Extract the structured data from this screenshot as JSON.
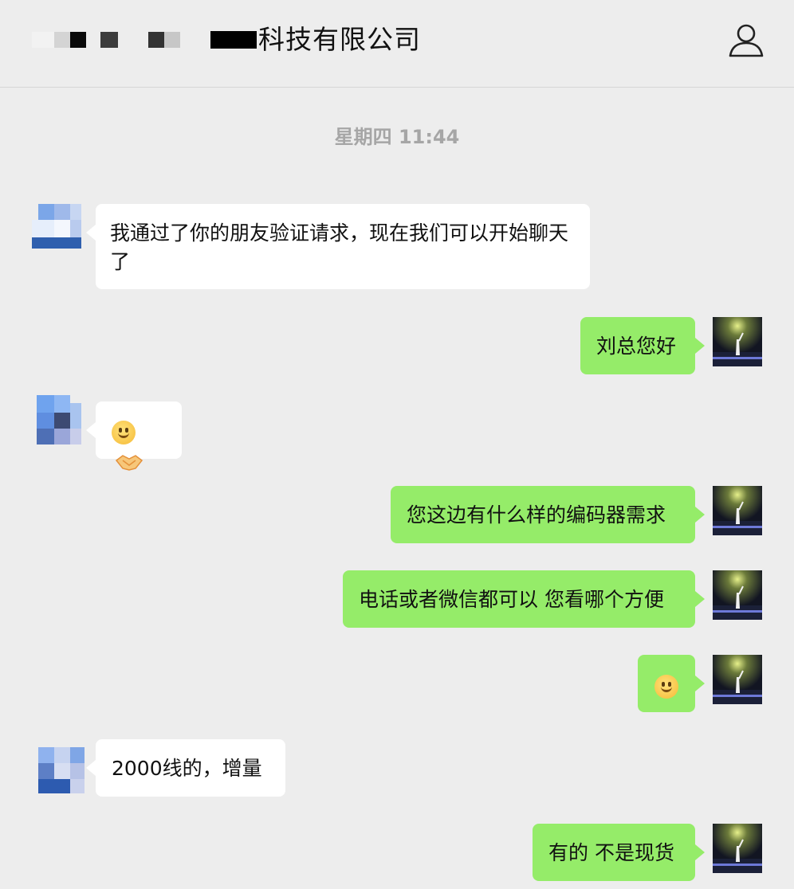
{
  "header": {
    "title": "科技有限公司",
    "profile_icon": "person-icon"
  },
  "timestamp": "星期四 11:44",
  "messages": [
    {
      "side": "in",
      "text": "我通过了你的朋友验证请求，现在我们可以开始聊天了"
    },
    {
      "side": "out",
      "text": "刘总您好"
    },
    {
      "side": "in",
      "emoji": [
        "smiling-face-emoji",
        "handshake-emoji"
      ]
    },
    {
      "side": "out",
      "text": "您这边有什么样的编码器需求"
    },
    {
      "side": "out",
      "text": "电话或者微信都可以 您看哪个方便"
    },
    {
      "side": "out",
      "emoji": [
        "blushing-face-emoji"
      ]
    },
    {
      "side": "in",
      "text": "2000线的，增量"
    },
    {
      "side": "out",
      "text": "有的 不是现货"
    }
  ],
  "colors": {
    "background": "#ededed",
    "incoming_bubble": "#ffffff",
    "outgoing_bubble": "#95ec69",
    "timestamp": "#a6a6a6"
  }
}
